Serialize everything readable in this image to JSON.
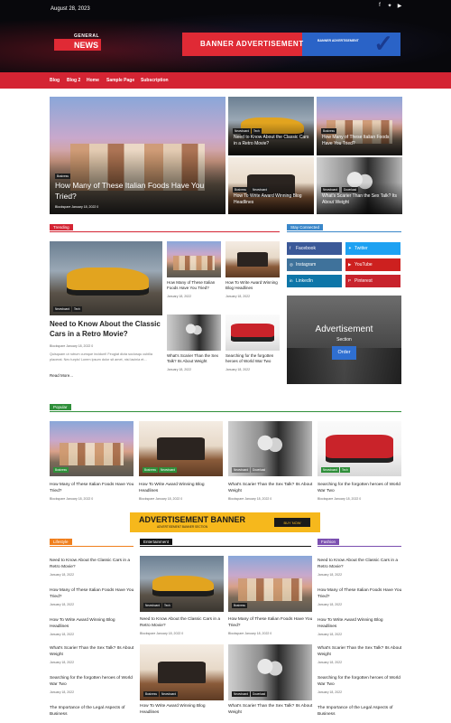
{
  "header": {
    "date": "August 28, 2023",
    "social_icons": [
      "facebook-icon",
      "twitter-icon",
      "youtube-icon"
    ],
    "logo": {
      "top": "GENERAL",
      "bottom": "NEWS"
    },
    "banner": {
      "title": "BANNER ADVERTISEMENT",
      "subtitle": "BANNER ADVERTISEMENT"
    }
  },
  "nav": {
    "items": [
      "Blog",
      "Blog 2",
      "Home",
      "Sample Page",
      "Subscription"
    ]
  },
  "hero": {
    "main": {
      "tag": "Business",
      "title": "How Many of These Italian Foods Have You Tried?",
      "meta": "Blockspare   January 18, 2022   0"
    },
    "grid": [
      {
        "tags": [
          "Newsboard",
          "Tech"
        ],
        "title": "Need to Know About the Classic Cars in a Retro Movie?"
      },
      {
        "tags": [
          "Business"
        ],
        "title": "How Many of These Italian Foods Have You Tried?"
      },
      {
        "tags": [
          "Business",
          "Newsboard"
        ],
        "title": "How To Write Award Winning Blog Headlines"
      },
      {
        "tags": [
          "Newsboard",
          "Download"
        ],
        "title": "What's Scarier Than the Sex Talk? Its About Weight"
      }
    ]
  },
  "trending": {
    "label": "Trending",
    "main": {
      "tags": [
        "Newsboard",
        "Tech"
      ],
      "title": "Need to Know About the Classic Cars in a Retro Movie?",
      "meta": "Blockspare   January 18, 2022   0",
      "excerpt": "Quisquam ut rutrum cumque incidunt! Feugiat dicta sociosqu cubilia placerat. Nec turpis! Lorem ipsum dolor sit amet, nisi lacinia et...",
      "read_more": "Read More..."
    },
    "items": [
      {
        "title": "How Many of These Italian Foods Have You Tried?",
        "meta": "January 18, 2022"
      },
      {
        "title": "How To Write Award Winning Blog Headlines",
        "meta": "January 18, 2022"
      },
      {
        "title": "What's Scarier Than the Sex Talk? Its About Weight",
        "meta": "January 18, 2022"
      },
      {
        "title": "Searching for the forgotten heroes of World War Two",
        "meta": "January 18, 2022"
      }
    ]
  },
  "stay_connected": {
    "label": "Stay Connected",
    "buttons": [
      {
        "label": "Facebook",
        "icon": "facebook-icon",
        "color": "#3b5998"
      },
      {
        "label": "Twitter",
        "icon": "twitter-icon",
        "color": "#1da1f2"
      },
      {
        "label": "Instagram",
        "icon": "instagram-icon",
        "color": "#3f729b"
      },
      {
        "label": "YouTube",
        "icon": "youtube-icon",
        "color": "#cd201f"
      },
      {
        "label": "LinkedIn",
        "icon": "linkedin-icon",
        "color": "#0e76a8"
      },
      {
        "label": "Pinterest",
        "icon": "pinterest-icon",
        "color": "#c8232c"
      }
    ],
    "ad": {
      "title": "Advertisement",
      "subtitle": "Section",
      "button": "Order"
    }
  },
  "popular": {
    "label": "Popular",
    "items": [
      {
        "tags": [
          "Business"
        ],
        "title": "How Many of These Italian Foods Have You Tried?",
        "meta": "Blockspare   January 18, 2022   0"
      },
      {
        "tags": [
          "Business",
          "Newsboard"
        ],
        "title": "How To Write Award Winning Blog Headlines",
        "meta": "Blockspare   January 18, 2022   0"
      },
      {
        "tags": [
          "Newsboard",
          "Download"
        ],
        "title": "What's Scarier Than the Sex Talk? Its About Weight",
        "meta": "Blockspare   January 18, 2022   0"
      },
      {
        "tags": [
          "Newsboard",
          "Tech"
        ],
        "title": "Searching for the forgotten heroes of World War Two",
        "meta": "Blockspare   January 18, 2022   0"
      }
    ]
  },
  "ad_banner": {
    "title": "ADVERTISEMENT BANNER",
    "subtitle": "ADVERTISEMENT BANNER SECTION",
    "button": "BUY NOW"
  },
  "lifestyle": {
    "label": "Lifestyle",
    "items": [
      {
        "title": "Need to Know About the Classic Cars in a Retro Movie?",
        "meta": "January 18, 2022"
      },
      {
        "title": "How Many of These Italian Foods Have You Tried?",
        "meta": "January 18, 2022"
      },
      {
        "title": "How To Write Award Winning Blog Headlines",
        "meta": "January 18, 2022"
      },
      {
        "title": "What's Scarier Than the Sex Talk? Its About Weight",
        "meta": "January 18, 2022"
      },
      {
        "title": "Searching for the forgotten heroes of World War Two",
        "meta": "January 18, 2022"
      },
      {
        "title": "The Importance of the Legal Aspects of Business",
        "meta": ""
      }
    ]
  },
  "entertainment": {
    "label": "Entertainment",
    "items": [
      {
        "tags": [
          "Newsboard",
          "Tech"
        ],
        "title": "Need to Know About the Classic Cars in a Retro Movie?",
        "meta": "Blockspare   January 18, 2022   0"
      },
      {
        "tags": [
          "Business"
        ],
        "title": "How Many of These Italian Foods Have You Tried?",
        "meta": "Blockspare   January 18, 2022   0"
      },
      {
        "tags": [
          "Business",
          "Newsboard"
        ],
        "title": "How To Write Award Winning Blog Headlines",
        "meta": ""
      },
      {
        "tags": [
          "Newsboard",
          "Download"
        ],
        "title": "What's Scarier Than the Sex Talk? Its About Weight",
        "meta": ""
      }
    ]
  },
  "fashion": {
    "label": "Fashion",
    "items": [
      {
        "title": "Need to Know About the Classic Cars in a Retro Movie?",
        "meta": "January 18, 2022"
      },
      {
        "title": "How Many of These Italian Foods Have You Tried?",
        "meta": "January 18, 2022"
      },
      {
        "title": "How To Write Award Winning Blog Headlines",
        "meta": "January 18, 2022"
      },
      {
        "title": "What's Scarier Than the Sex Talk? Its About Weight",
        "meta": "January 18, 2022"
      },
      {
        "title": "Searching for the forgotten heroes of World War Two",
        "meta": "January 18, 2022"
      },
      {
        "title": "The Importance of the Legal Aspects of Business",
        "meta": ""
      }
    ]
  },
  "colors": {
    "accent": "#d42433",
    "trending": "#d42433",
    "stay": "#3a87c9",
    "popular": "#2f8f3a",
    "lifestyle": "#f07f1d",
    "entertainment": "#111111",
    "fashion": "#7b4fb0"
  }
}
